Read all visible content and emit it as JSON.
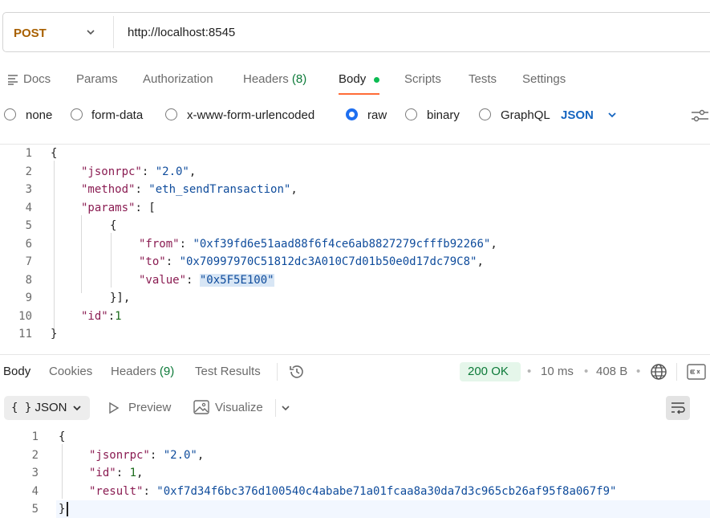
{
  "request": {
    "method": "POST",
    "url": "http://localhost:8545",
    "tabs": {
      "docs": "Docs",
      "params": "Params",
      "authorization": "Authorization",
      "headers": "Headers",
      "headers_count": "(8)",
      "body": "Body",
      "scripts": "Scripts",
      "tests": "Tests",
      "settings": "Settings"
    },
    "body_types": {
      "none": "none",
      "form_data": "form-data",
      "urlencoded": "x-www-form-urlencoded",
      "raw": "raw",
      "binary": "binary",
      "graphql": "GraphQL",
      "selected": "raw"
    },
    "language": "JSON",
    "line_numbers": [
      "1",
      "2",
      "3",
      "4",
      "5",
      "6",
      "7",
      "8",
      "9",
      "10",
      "11"
    ],
    "code": {
      "l1": "{",
      "l2_key": "\"jsonrpc\"",
      "l2_val": "\"2.0\"",
      "l3_key": "\"method\"",
      "l3_val": "\"eth_sendTransaction\"",
      "l4_key": "\"params\"",
      "l4_rest": ": [",
      "l5": "{",
      "l6_key": "\"from\"",
      "l6_val": "\"0xf39fd6e51aad88f6f4ce6ab8827279cfffb92266\"",
      "l7_key": "\"to\"",
      "l7_val": "\"0x70997970C51812dc3A010C7d01b50e0d17dc79C8\"",
      "l8_key": "\"value\"",
      "l8_val": "\"0x5F5E100\"",
      "l9": "}],",
      "l10_key": "\"id\"",
      "l10_val": "1",
      "l11": "}"
    }
  },
  "response": {
    "tabs": {
      "body": "Body",
      "cookies": "Cookies",
      "headers": "Headers",
      "headers_count": "(9)",
      "test_results": "Test Results"
    },
    "status": "200 OK",
    "time": "10 ms",
    "size": "408 B",
    "format": "JSON",
    "preview": "Preview",
    "visualize": "Visualize",
    "line_numbers": [
      "1",
      "2",
      "3",
      "4",
      "5"
    ],
    "code": {
      "l1": "{",
      "l2_key": "\"jsonrpc\"",
      "l2_val": "\"2.0\"",
      "l3_key": "\"id\"",
      "l3_val": "1",
      "l4_key": "\"result\"",
      "l4_val": "\"0xf7d34f6bc376d100540c4ababe71a01fcaa8a30da7d3c965cb26af95f8a067f9\"",
      "l5": "}"
    }
  },
  "colors": {
    "accent": "#ff6c37",
    "method": "#a86000",
    "json_key": "#8a1c52",
    "json_string": "#0f4c9c",
    "json_number": "#1c6b1c",
    "status_ok": "#0d7a39",
    "radio_selected": "#1e6ff0"
  }
}
